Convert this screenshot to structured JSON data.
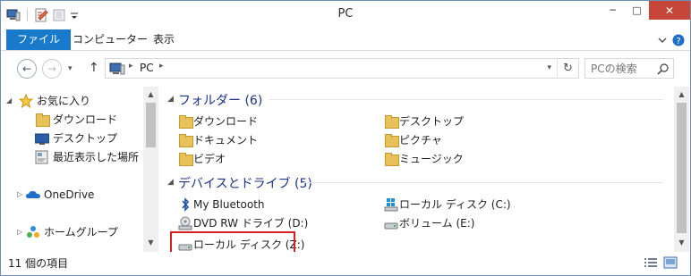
{
  "window": {
    "title": "PC"
  },
  "window_buttons": {
    "minimize": "─",
    "maximize": "□",
    "close": "✕"
  },
  "ribbon": {
    "file": "ファイル",
    "computer": "コンピューター",
    "view": "表示"
  },
  "address": {
    "crumb": "PC",
    "chevron": "▸",
    "dropdown": "▾",
    "refresh": "↻"
  },
  "search": {
    "placeholder": "PCの検索"
  },
  "nav_buttons": {
    "back": "←",
    "forward": "→",
    "up": "↑",
    "recent": "▾"
  },
  "navpane": {
    "items": [
      {
        "label": "お気に入り",
        "icon": "star-icon",
        "expander": "◢"
      },
      {
        "label": "ダウンロード",
        "icon": "download-folder-icon"
      },
      {
        "label": "デスクトップ",
        "icon": "desktop-icon"
      },
      {
        "label": "最近表示した場所",
        "icon": "recent-places-icon"
      },
      {
        "label": "OneDrive",
        "icon": "cloud-icon",
        "expander": "▷"
      },
      {
        "label": "ホームグループ",
        "icon": "homegroup-icon",
        "expander": "▷"
      }
    ]
  },
  "scrollbar": {
    "up": "▲",
    "down": "▼"
  },
  "content": {
    "folders_header": "フォルダー (6)",
    "folders": [
      "ダウンロード",
      "デスクトップ",
      "ドキュメント",
      "ピクチャ",
      "ビデオ",
      "ミュージック"
    ],
    "devices_header": "デバイスとドライブ (5)",
    "devices": [
      "My Bluetooth",
      "ローカル ディスク (C:)",
      "DVD RW ドライブ (D:)",
      "ボリューム (E:)",
      "ローカル ディスク (Z:)"
    ],
    "group_chevron": "◢"
  },
  "status": {
    "count": "11 個の項目"
  },
  "colors": {
    "file_tab": "#1979ca",
    "close_button": "#c7463a",
    "group_header": "#1e3287",
    "highlight_border": "#d62121"
  }
}
